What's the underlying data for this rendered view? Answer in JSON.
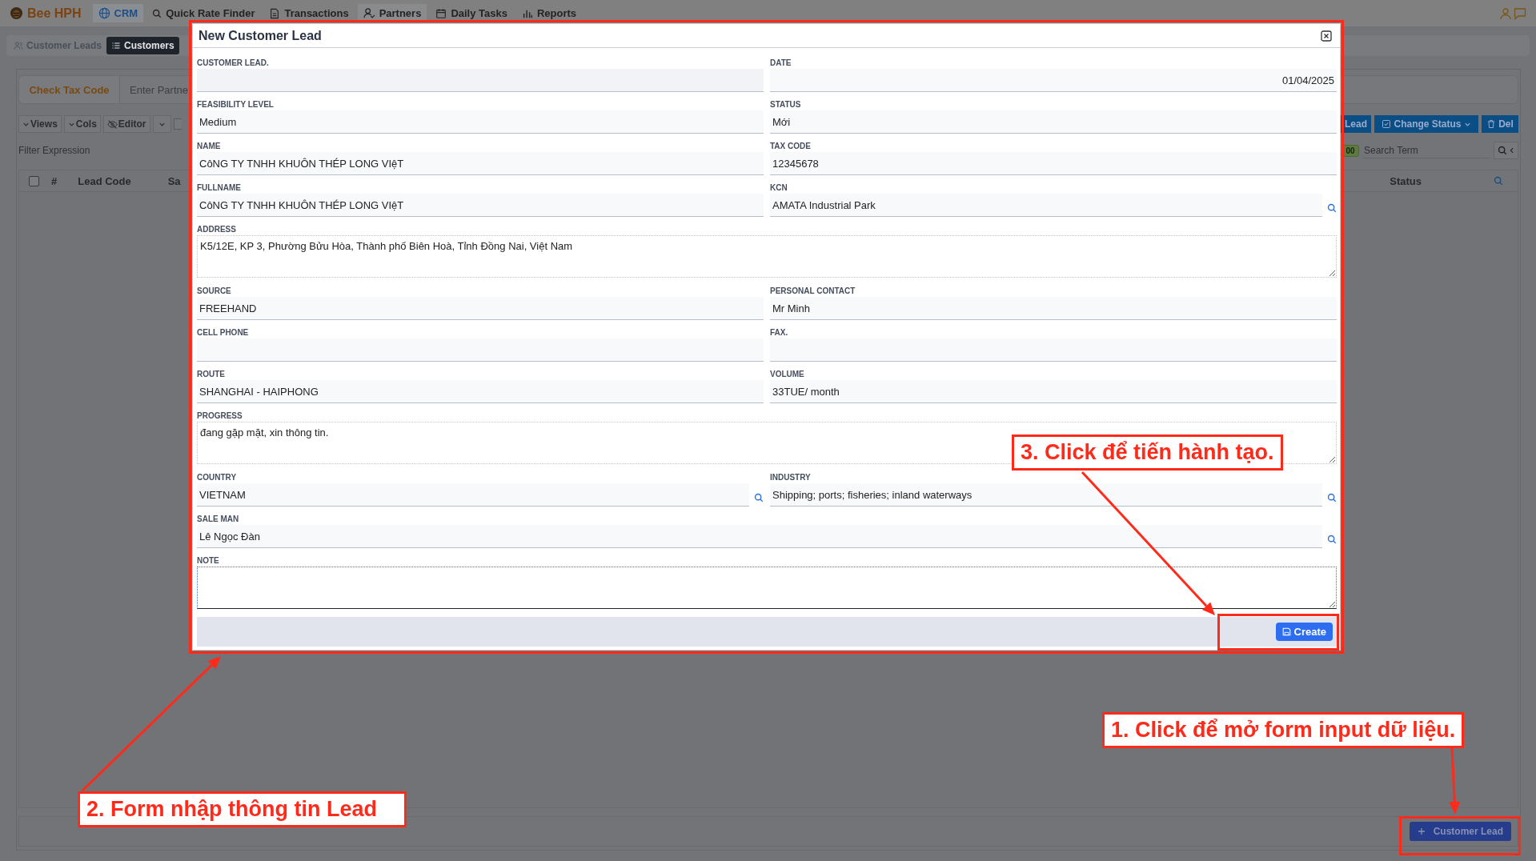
{
  "nav": {
    "brand": "Bee HPH",
    "items": [
      {
        "label": "CRM",
        "selected": true,
        "hovered": false
      },
      {
        "label": "Quick Rate Finder",
        "selected": false,
        "hovered": false
      },
      {
        "label": "Transactions",
        "selected": false,
        "hovered": false
      },
      {
        "label": "Partners",
        "selected": false,
        "hovered": true
      },
      {
        "label": "Daily Tasks",
        "selected": false,
        "hovered": false
      },
      {
        "label": "Reports",
        "selected": false,
        "hovered": false
      }
    ]
  },
  "tabs": [
    {
      "label": "Customer Leads",
      "selected": false
    },
    {
      "label": "Customers",
      "selected": true
    }
  ],
  "tax_bar": {
    "button": "Check Tax Code",
    "partner_field": {
      "placeholder": "Enter Partne"
    }
  },
  "toolbar": {
    "left": [
      "Views",
      "Cols",
      "Editor"
    ],
    "right": [
      "Lead",
      "Change Status",
      "Del"
    ]
  },
  "filter": {
    "placeholder": "Filter Expression",
    "badge": "00",
    "search": {
      "placeholder": "Search Term"
    }
  },
  "table": {
    "select_all": {
      "checked": false
    },
    "columns": [
      "#",
      "Lead Code",
      "Sa",
      "Status"
    ]
  },
  "footer_button": "Customer Lead",
  "dialog": {
    "title": "New Customer Lead",
    "rows": [
      [
        {
          "label": "CUSTOMER LEAD.",
          "kind": "readonly"
        },
        {
          "label": "DATE",
          "kind": "date",
          "value": "01/04/2025"
        }
      ],
      [
        {
          "label": "FEASIBILITY LEVEL",
          "kind": "text",
          "value": "Medium"
        },
        {
          "label": "STATUS",
          "kind": "text",
          "value": "Mới"
        }
      ],
      [
        {
          "label": "NAME",
          "kind": "text",
          "value": "CôNG TY TNHH KHUÔN THÉP LONG VIệT"
        },
        {
          "label": "TAX CODE",
          "kind": "text",
          "value": "12345678"
        }
      ],
      [
        {
          "label": "FULLNAME",
          "kind": "text",
          "value": "CôNG TY TNHH KHUÔN THÉP LONG VIệT"
        },
        {
          "label": "KCN",
          "kind": "lookup",
          "value": "AMATA Industrial Park"
        }
      ],
      [
        {
          "label": "ADDRESS",
          "kind": "textarea",
          "value": "K5/12E, KP 3, Phường Bửu Hòa, Thành phố Biên Hoà, Tỉnh Đồng Nai, Việt Nam",
          "focused": false
        }
      ],
      [
        {
          "label": "SOURCE",
          "kind": "text",
          "value": "FREEHAND"
        },
        {
          "label": "PERSONAL CONTACT",
          "kind": "text",
          "value": "Mr Minh"
        }
      ],
      [
        {
          "label": "CELL PHONE",
          "kind": "text"
        },
        {
          "label": "FAX.",
          "kind": "text"
        }
      ],
      [
        {
          "label": "ROUTE",
          "kind": "text",
          "value": "SHANGHAI - HAIPHONG"
        },
        {
          "label": "VOLUME",
          "kind": "text",
          "value": "33TUE/ month"
        }
      ],
      [
        {
          "label": "PROGRESS",
          "kind": "textarea",
          "value": "đang gặp mặt, xin thông tin.",
          "focused": false
        }
      ],
      [
        {
          "label": "COUNTRY",
          "kind": "lookup",
          "value": "VIETNAM"
        },
        {
          "label": "INDUSTRY",
          "kind": "lookup",
          "value": "Shipping; ports; fisheries; inland waterways"
        }
      ],
      [
        {
          "label": "SALE MAN",
          "kind": "lookup",
          "value": "Lê Ngọc Đàn"
        }
      ],
      [
        {
          "label": "NOTE",
          "kind": "textarea",
          "focused": true
        }
      ]
    ],
    "create_button": "Create"
  },
  "annotations": [
    {
      "text": "3. Click để tiến hành tạo."
    },
    {
      "text": "1. Click để mở form input dữ liệu."
    },
    {
      "text": "2. Form nhập thông tin Lead"
    }
  ]
}
